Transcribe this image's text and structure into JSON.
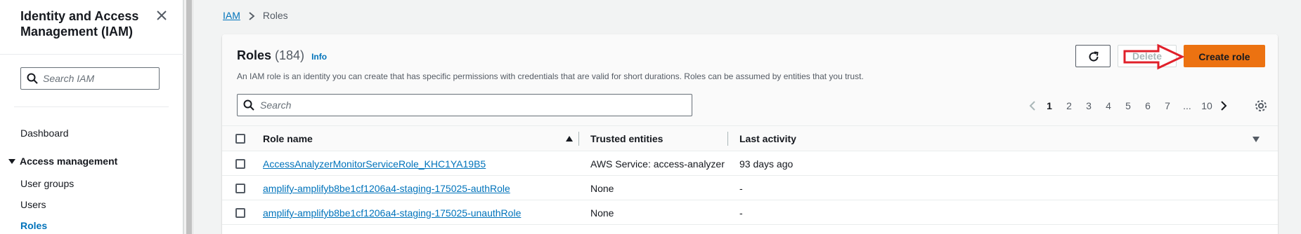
{
  "sidebar": {
    "title": "Identity and Access Management (IAM)",
    "search_placeholder": "Search IAM",
    "dashboard": "Dashboard",
    "section": "Access management",
    "items": [
      {
        "label": "User groups"
      },
      {
        "label": "Users"
      },
      {
        "label": "Roles"
      }
    ]
  },
  "breadcrumb": {
    "root": "IAM",
    "current": "Roles"
  },
  "header": {
    "title": "Roles",
    "count": "(184)",
    "info": "Info",
    "description": "An IAM role is an identity you can create that has specific permissions with credentials that are valid for short durations. Roles can be assumed by entities that you trust.",
    "delete_label": "Delete",
    "create_label": "Create role",
    "search_placeholder": "Search"
  },
  "pagination": {
    "pages": [
      "1",
      "2",
      "3",
      "4",
      "5",
      "6",
      "7",
      "...",
      "10"
    ],
    "current": "1"
  },
  "table": {
    "columns": {
      "name": "Role name",
      "trusted": "Trusted entities",
      "last": "Last activity"
    },
    "rows": [
      {
        "name": "AccessAnalyzerMonitorServiceRole_KHC1YA19B5",
        "trusted": "AWS Service: access-analyzer",
        "last": "93 days ago"
      },
      {
        "name": "amplify-amplifyb8be1cf1206a4-staging-175025-authRole",
        "trusted": "None",
        "last": "-"
      },
      {
        "name": "amplify-amplifyb8be1cf1206a4-staging-175025-unauthRole",
        "trusted": "None",
        "last": "-"
      }
    ]
  },
  "colors": {
    "accent": "#0073bb",
    "primary_button": "#ec7211",
    "annotation_arrow": "#e0202a"
  },
  "icons": [
    "close-icon",
    "search-icon",
    "chevron-right-icon",
    "refresh-icon",
    "chevron-left-icon",
    "gear-icon",
    "arrow-annotation"
  ]
}
